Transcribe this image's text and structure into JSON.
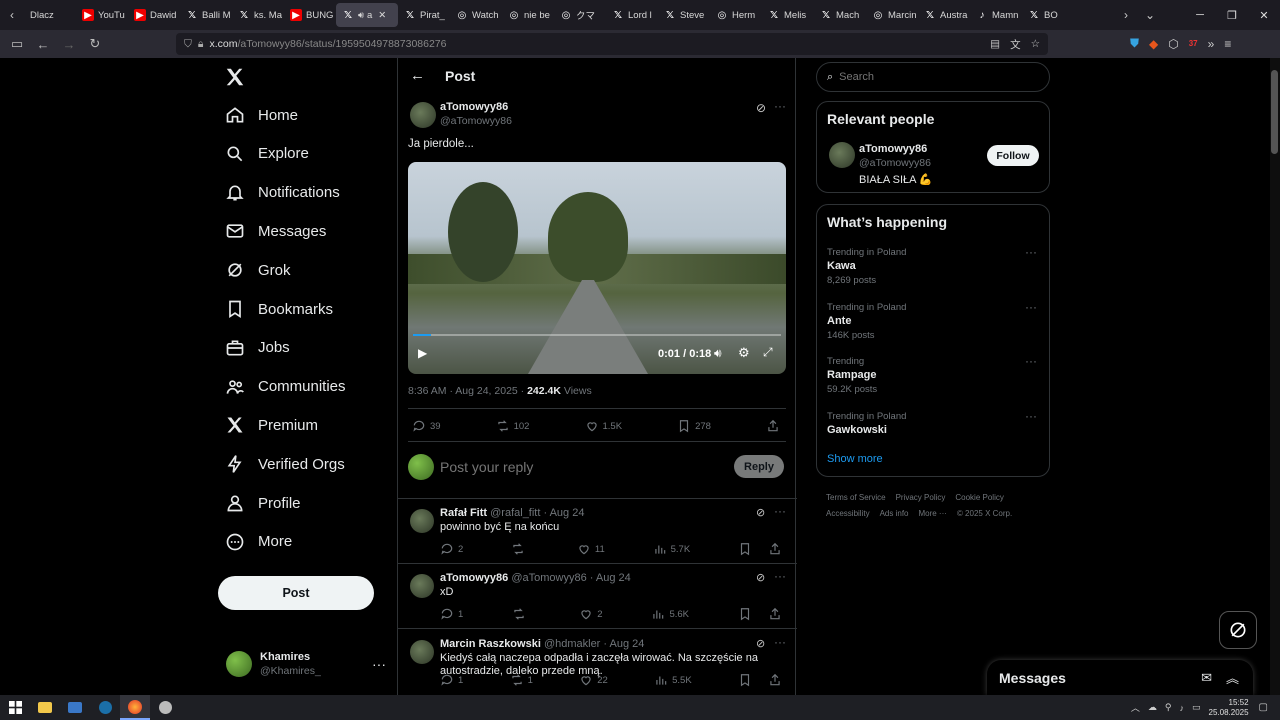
{
  "browser": {
    "tabs": [
      {
        "label": "Dlacz",
        "icon": "text"
      },
      {
        "label": "YouTu",
        "icon": "youtube-icon"
      },
      {
        "label": "Dawid",
        "icon": "youtube-icon"
      },
      {
        "label": "Balli M",
        "icon": "x-icon"
      },
      {
        "label": "ks. Ma",
        "icon": "x-icon"
      },
      {
        "label": "BUNG",
        "icon": "youtube-icon"
      },
      {
        "label": "a",
        "icon": "x-icon",
        "active": true
      },
      {
        "label": "Pirat_",
        "icon": "x-icon"
      },
      {
        "label": "Watch",
        "icon": "tab-icon"
      },
      {
        "label": "nie be",
        "icon": "tab-icon"
      },
      {
        "label": "クマ",
        "icon": "tab-icon"
      },
      {
        "label": "Lord l",
        "icon": "x-icon"
      },
      {
        "label": "Steve",
        "icon": "x-icon"
      },
      {
        "label": "Herm",
        "icon": "tab-icon"
      },
      {
        "label": "Melis",
        "icon": "x-icon"
      },
      {
        "label": "Mach",
        "icon": "x-icon"
      },
      {
        "label": "Marcin",
        "icon": "tab-icon"
      },
      {
        "label": "Austra",
        "icon": "x-icon"
      },
      {
        "label": "Mamn",
        "icon": "tiktok-icon"
      },
      {
        "label": "BO",
        "icon": "x-icon"
      }
    ],
    "url_host": "x.com",
    "url_path": "/aTomowyy86/status/1959504978873086276",
    "extension_badge": "37"
  },
  "sidebar": {
    "items": [
      {
        "label": "Home",
        "icon": "home-icon"
      },
      {
        "label": "Explore",
        "icon": "search-icon"
      },
      {
        "label": "Notifications",
        "icon": "bell-icon"
      },
      {
        "label": "Messages",
        "icon": "mail-icon"
      },
      {
        "label": "Grok",
        "icon": "grok-icon"
      },
      {
        "label": "Bookmarks",
        "icon": "bookmark-icon"
      },
      {
        "label": "Jobs",
        "icon": "briefcase-icon"
      },
      {
        "label": "Communities",
        "icon": "people-icon"
      },
      {
        "label": "Premium",
        "icon": "x-icon"
      },
      {
        "label": "Verified Orgs",
        "icon": "lightning-icon"
      },
      {
        "label": "Profile",
        "icon": "person-icon"
      },
      {
        "label": "More",
        "icon": "more-circle-icon"
      }
    ],
    "post_button": "Post",
    "account": {
      "name": "Khamires",
      "handle": "@Khamires_"
    }
  },
  "main": {
    "header_title": "Post",
    "post": {
      "author_name": "aTomowyy86",
      "author_handle": "@aTomowyy86",
      "text": "Ja pierdole...",
      "video": {
        "time_current": "0:01",
        "time_sep": "/",
        "time_total": "0:18",
        "progress": 0.05
      },
      "timestamp": "8:36 AM · Aug 24, 2025 ·",
      "views_count": "242.4K",
      "views_label": "Views",
      "replies": "39",
      "reposts": "102",
      "likes": "1.5K",
      "bookmarks": "278"
    },
    "reply_box": {
      "placeholder": "Post your reply",
      "button": "Reply"
    },
    "replies": [
      {
        "name": "Rafał Fitt",
        "handle": "@rafal_fitt",
        "date": "· Aug 24",
        "text": "powinno być Ę na końcu",
        "replies": "2",
        "reposts": "",
        "likes": "11",
        "views": "5.7K"
      },
      {
        "name": "aTomowyy86",
        "handle": "@aTomowyy86",
        "date": "· Aug 24",
        "text": "xD",
        "replies": "1",
        "reposts": "",
        "likes": "2",
        "views": "5.6K"
      },
      {
        "name": "Marcin Raszkowski",
        "handle": "@hdmakler",
        "date": "· Aug 24",
        "text": "Kiedyś całą naczepa odpadła i zaczęła wirować. Na szczęście na autostradzie, daleko przede mną.",
        "replies": "1",
        "reposts": "1",
        "likes": "22",
        "views": "5.5K"
      }
    ]
  },
  "right": {
    "search_placeholder": "Search",
    "relevant_title": "Relevant people",
    "relevant": {
      "name": "aTomowyy86",
      "handle": "@aTomowyy86",
      "bio": "BIAŁA SIŁA 💪",
      "follow": "Follow"
    },
    "happening_title": "What’s happening",
    "trends": [
      {
        "context": "Trending in Poland",
        "topic": "Kawa",
        "posts": "8,269 posts"
      },
      {
        "context": "Trending in Poland",
        "topic": "Ante",
        "posts": "146K posts"
      },
      {
        "context": "Trending",
        "topic": "Rampage",
        "posts": "59.2K posts"
      },
      {
        "context": "Trending in Poland",
        "topic": "Gawkowski",
        "posts": ""
      }
    ],
    "show_more": "Show more",
    "footer": [
      "Terms of Service",
      "Privacy Policy",
      "Cookie Policy",
      "Accessibility",
      "Ads info",
      "More ···",
      "© 2025 X Corp."
    ]
  },
  "messages_dock": {
    "title": "Messages"
  },
  "taskbar": {
    "time": "15:52",
    "date": "25.08.2025"
  },
  "colors": {
    "accent": "#1d9bf0",
    "background": "#000000",
    "border": "#2f3336",
    "muted": "#71767b"
  }
}
